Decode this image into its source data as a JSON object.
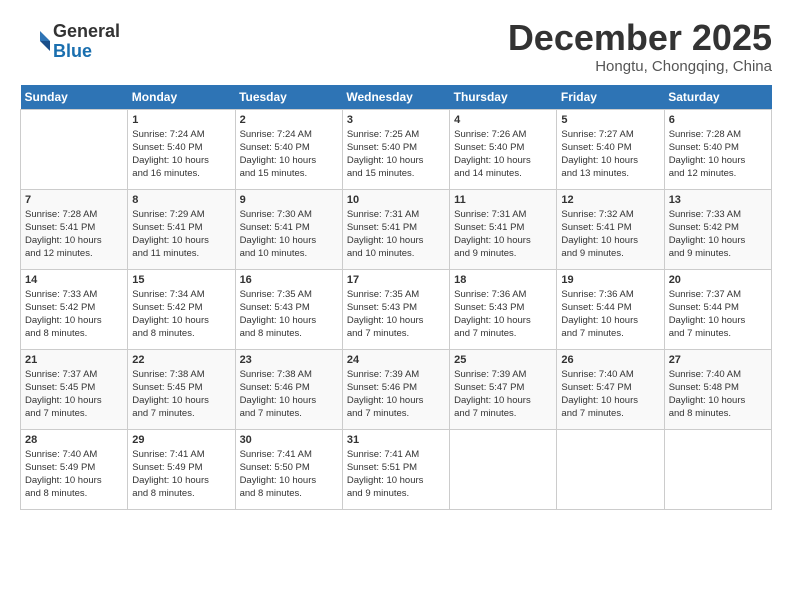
{
  "header": {
    "logo_general": "General",
    "logo_blue": "Blue",
    "month": "December 2025",
    "location": "Hongtu, Chongqing, China"
  },
  "days_of_week": [
    "Sunday",
    "Monday",
    "Tuesday",
    "Wednesday",
    "Thursday",
    "Friday",
    "Saturday"
  ],
  "weeks": [
    [
      {
        "day": "",
        "info": ""
      },
      {
        "day": "1",
        "info": "Sunrise: 7:24 AM\nSunset: 5:40 PM\nDaylight: 10 hours\nand 16 minutes."
      },
      {
        "day": "2",
        "info": "Sunrise: 7:24 AM\nSunset: 5:40 PM\nDaylight: 10 hours\nand 15 minutes."
      },
      {
        "day": "3",
        "info": "Sunrise: 7:25 AM\nSunset: 5:40 PM\nDaylight: 10 hours\nand 15 minutes."
      },
      {
        "day": "4",
        "info": "Sunrise: 7:26 AM\nSunset: 5:40 PM\nDaylight: 10 hours\nand 14 minutes."
      },
      {
        "day": "5",
        "info": "Sunrise: 7:27 AM\nSunset: 5:40 PM\nDaylight: 10 hours\nand 13 minutes."
      },
      {
        "day": "6",
        "info": "Sunrise: 7:28 AM\nSunset: 5:40 PM\nDaylight: 10 hours\nand 12 minutes."
      }
    ],
    [
      {
        "day": "7",
        "info": "Sunrise: 7:28 AM\nSunset: 5:41 PM\nDaylight: 10 hours\nand 12 minutes."
      },
      {
        "day": "8",
        "info": "Sunrise: 7:29 AM\nSunset: 5:41 PM\nDaylight: 10 hours\nand 11 minutes."
      },
      {
        "day": "9",
        "info": "Sunrise: 7:30 AM\nSunset: 5:41 PM\nDaylight: 10 hours\nand 10 minutes."
      },
      {
        "day": "10",
        "info": "Sunrise: 7:31 AM\nSunset: 5:41 PM\nDaylight: 10 hours\nand 10 minutes."
      },
      {
        "day": "11",
        "info": "Sunrise: 7:31 AM\nSunset: 5:41 PM\nDaylight: 10 hours\nand 9 minutes."
      },
      {
        "day": "12",
        "info": "Sunrise: 7:32 AM\nSunset: 5:41 PM\nDaylight: 10 hours\nand 9 minutes."
      },
      {
        "day": "13",
        "info": "Sunrise: 7:33 AM\nSunset: 5:42 PM\nDaylight: 10 hours\nand 9 minutes."
      }
    ],
    [
      {
        "day": "14",
        "info": "Sunrise: 7:33 AM\nSunset: 5:42 PM\nDaylight: 10 hours\nand 8 minutes."
      },
      {
        "day": "15",
        "info": "Sunrise: 7:34 AM\nSunset: 5:42 PM\nDaylight: 10 hours\nand 8 minutes."
      },
      {
        "day": "16",
        "info": "Sunrise: 7:35 AM\nSunset: 5:43 PM\nDaylight: 10 hours\nand 8 minutes."
      },
      {
        "day": "17",
        "info": "Sunrise: 7:35 AM\nSunset: 5:43 PM\nDaylight: 10 hours\nand 7 minutes."
      },
      {
        "day": "18",
        "info": "Sunrise: 7:36 AM\nSunset: 5:43 PM\nDaylight: 10 hours\nand 7 minutes."
      },
      {
        "day": "19",
        "info": "Sunrise: 7:36 AM\nSunset: 5:44 PM\nDaylight: 10 hours\nand 7 minutes."
      },
      {
        "day": "20",
        "info": "Sunrise: 7:37 AM\nSunset: 5:44 PM\nDaylight: 10 hours\nand 7 minutes."
      }
    ],
    [
      {
        "day": "21",
        "info": "Sunrise: 7:37 AM\nSunset: 5:45 PM\nDaylight: 10 hours\nand 7 minutes."
      },
      {
        "day": "22",
        "info": "Sunrise: 7:38 AM\nSunset: 5:45 PM\nDaylight: 10 hours\nand 7 minutes."
      },
      {
        "day": "23",
        "info": "Sunrise: 7:38 AM\nSunset: 5:46 PM\nDaylight: 10 hours\nand 7 minutes."
      },
      {
        "day": "24",
        "info": "Sunrise: 7:39 AM\nSunset: 5:46 PM\nDaylight: 10 hours\nand 7 minutes."
      },
      {
        "day": "25",
        "info": "Sunrise: 7:39 AM\nSunset: 5:47 PM\nDaylight: 10 hours\nand 7 minutes."
      },
      {
        "day": "26",
        "info": "Sunrise: 7:40 AM\nSunset: 5:47 PM\nDaylight: 10 hours\nand 7 minutes."
      },
      {
        "day": "27",
        "info": "Sunrise: 7:40 AM\nSunset: 5:48 PM\nDaylight: 10 hours\nand 8 minutes."
      }
    ],
    [
      {
        "day": "28",
        "info": "Sunrise: 7:40 AM\nSunset: 5:49 PM\nDaylight: 10 hours\nand 8 minutes."
      },
      {
        "day": "29",
        "info": "Sunrise: 7:41 AM\nSunset: 5:49 PM\nDaylight: 10 hours\nand 8 minutes."
      },
      {
        "day": "30",
        "info": "Sunrise: 7:41 AM\nSunset: 5:50 PM\nDaylight: 10 hours\nand 8 minutes."
      },
      {
        "day": "31",
        "info": "Sunrise: 7:41 AM\nSunset: 5:51 PM\nDaylight: 10 hours\nand 9 minutes."
      },
      {
        "day": "",
        "info": ""
      },
      {
        "day": "",
        "info": ""
      },
      {
        "day": "",
        "info": ""
      }
    ]
  ]
}
